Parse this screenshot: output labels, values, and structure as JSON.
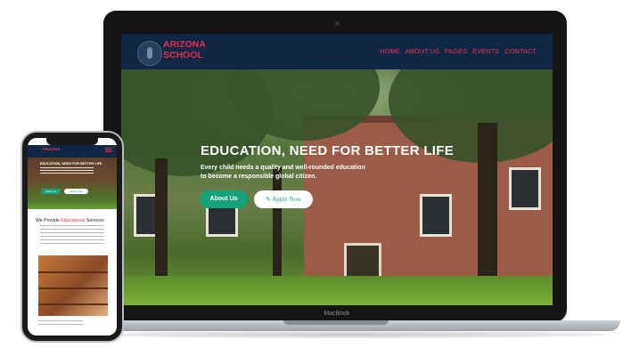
{
  "site": {
    "logo_line1": "ARIZONA",
    "logo_line2": "SCHOOL",
    "nav": [
      "HOME",
      "ABOUT US",
      "PAGES",
      "EVENTS",
      "CONTACT"
    ],
    "hero_title": "EDUCATION, NEED FOR BETTER LIFE",
    "hero_subtitle_line1": "Every child needs a quality and well-rounded education",
    "hero_subtitle_line2": "to become a responsible global citizen.",
    "about_button": "About Us",
    "apply_button": "Apply Now"
  },
  "device": {
    "laptop_brand": "MacBook",
    "phone_time": "9:41"
  },
  "mobile": {
    "hero_title": "EDUCATION, NEED FOR BETTER LIFE",
    "about_button": "About Us",
    "apply_button": "Apply Now",
    "section_title_prefix": "We Provide ",
    "section_title_highlight": "Educational",
    "section_title_suffix": " Services"
  },
  "colors": {
    "header_bg": "#0f2744",
    "brand_red": "#e0314b",
    "primary_green": "#16a37a"
  },
  "icons": {
    "apply": "pencil-icon",
    "menu": "hamburger-menu-icon",
    "logo": "school-emblem-icon"
  }
}
